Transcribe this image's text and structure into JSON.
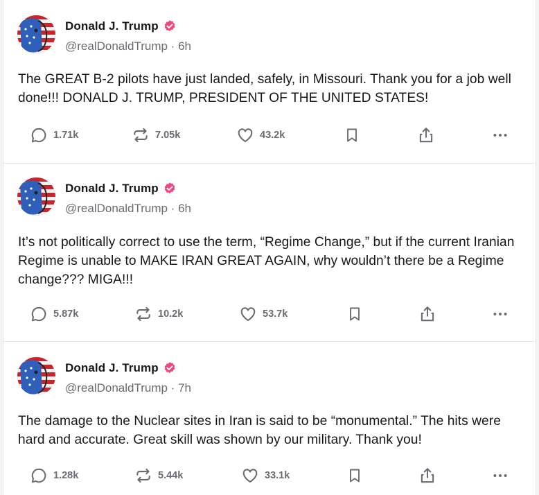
{
  "colors": {
    "verified": "#f0477a",
    "text": "#17171a",
    "muted": "#6a6a73",
    "divider": "#e6e6e9"
  },
  "posts": [
    {
      "author": "Donald J. Trump",
      "handle": "@realDonaldTrump · 6h",
      "text": "The GREAT B-2 pilots have just landed, safely, in Missouri. Thank you for a job well done!!! DONALD J. TRUMP, PRESIDENT OF THE UNITED STATES!",
      "replies": "1.71k",
      "reposts": "7.05k",
      "likes": "43.2k"
    },
    {
      "author": "Donald J. Trump",
      "handle": "@realDonaldTrump · 6h",
      "text": "It’s not politically correct to use the term, “Regime Change,” but if the current Iranian Regime is unable to MAKE IRAN GREAT AGAIN, why wouldn’t there be a Regime change??? MIGA!!!",
      "replies": "5.87k",
      "reposts": "10.2k",
      "likes": "53.7k"
    },
    {
      "author": "Donald J. Trump",
      "handle": "@realDonaldTrump · 7h",
      "text": "The damage to the Nuclear sites in Iran is said to be “monumental.” The hits were hard and accurate. Great skill was shown by our military. Thank you!",
      "replies": "1.28k",
      "reposts": "5.44k",
      "likes": "33.1k"
    }
  ],
  "icons": {
    "reply": "speech-bubble-icon",
    "repost": "repost-arrows-icon",
    "like": "heart-icon",
    "bookmark": "bookmark-icon",
    "share": "share-upload-icon",
    "more": "ellipsis-icon"
  }
}
